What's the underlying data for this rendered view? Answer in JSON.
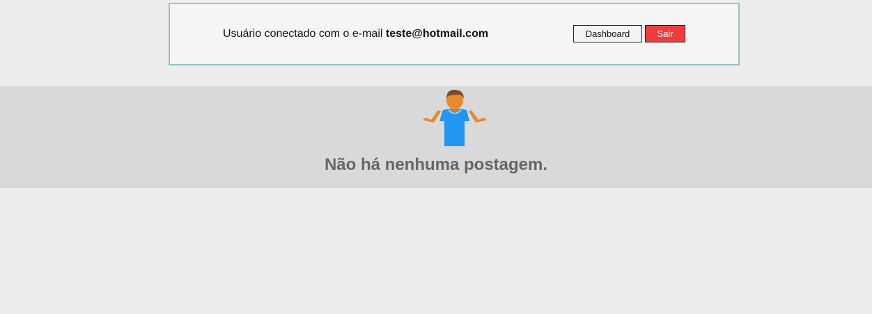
{
  "header": {
    "user_prefix": "Usuário conectado com o e-mail ",
    "user_email": "teste@hotmail.com",
    "dashboard_label": "Dashboard",
    "logout_label": "Sair"
  },
  "empty_state": {
    "icon": "person-shrugging-icon",
    "message": "Não há nenhuma postagem."
  },
  "colors": {
    "logout_button": "#f23b3b",
    "header_border": "#8fc6c8",
    "shirt": "#2196f3",
    "skin": "#e8892a"
  }
}
